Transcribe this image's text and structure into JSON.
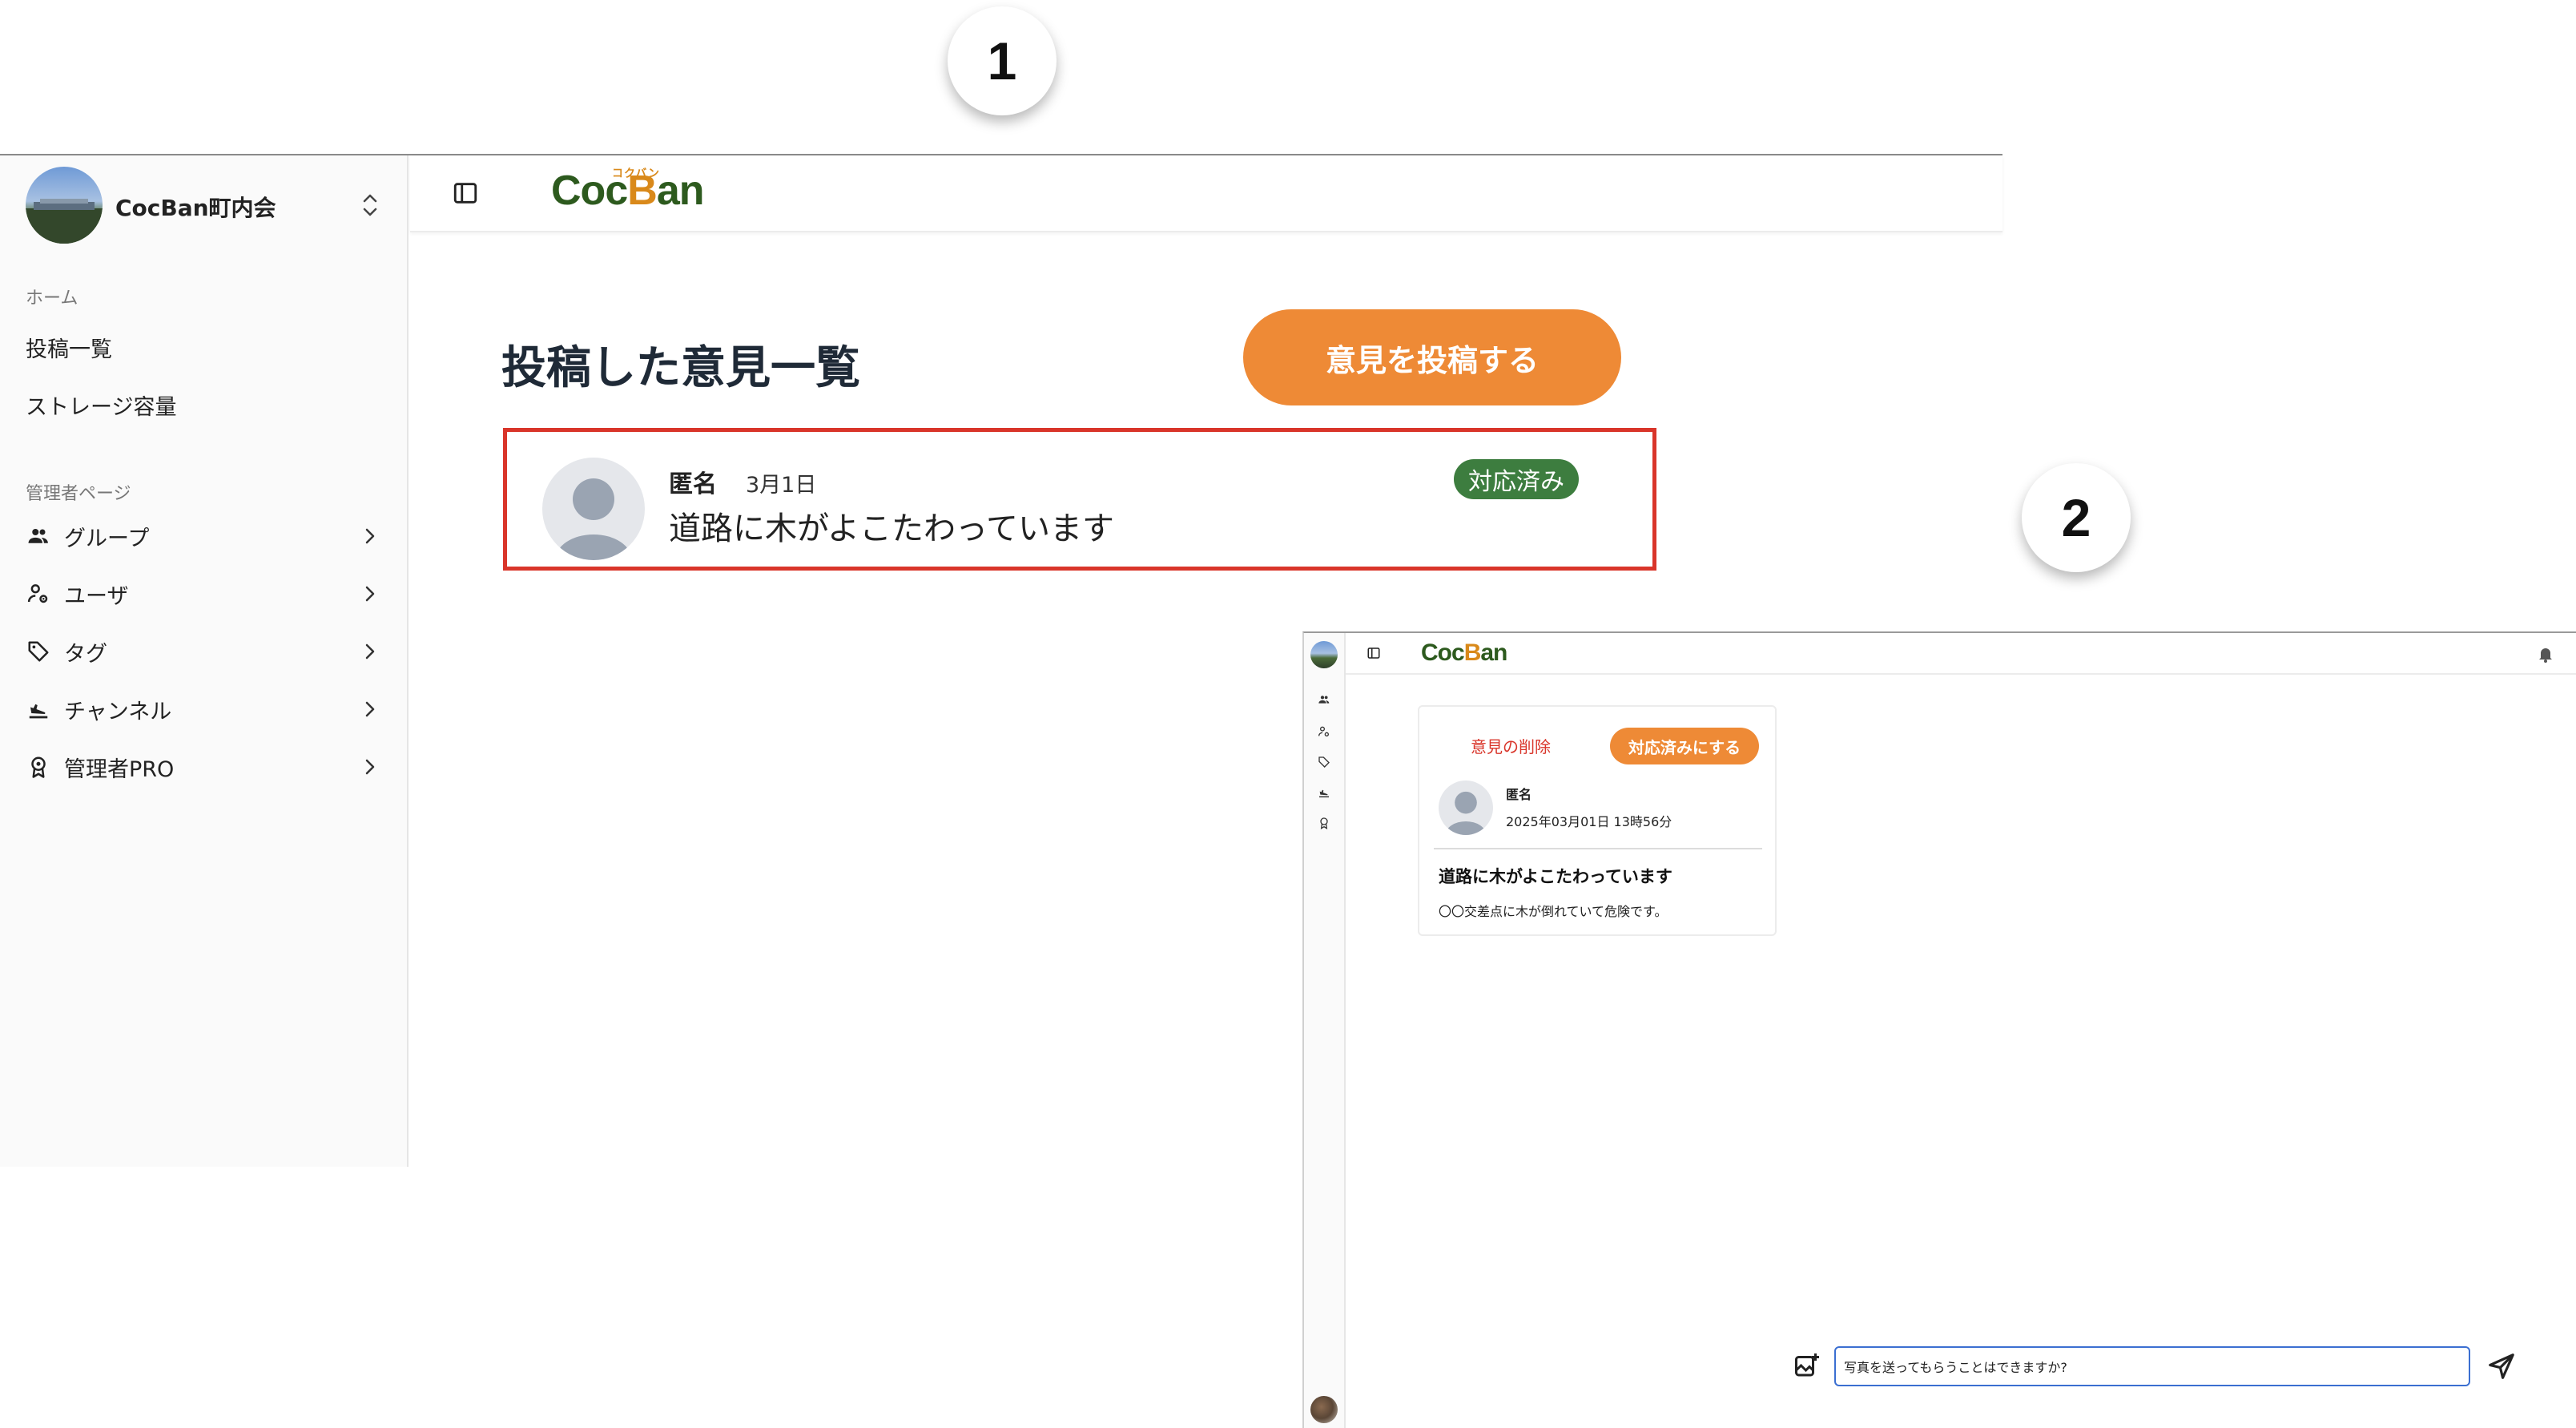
{
  "badges": {
    "step1": "1",
    "step2": "2"
  },
  "screen1": {
    "org_name": "CocBan町内会",
    "section_home": "ホーム",
    "home_items": [
      "投稿一覧",
      "ストレージ容量"
    ],
    "section_admin": "管理者ページ",
    "admin_items": [
      {
        "label": "グループ",
        "icon": "group-icon"
      },
      {
        "label": "ユーザ",
        "icon": "users-settings-icon"
      },
      {
        "label": "タグ",
        "icon": "tag-icon"
      },
      {
        "label": "チャンネル",
        "icon": "channel-icon"
      },
      {
        "label": "管理者PRO",
        "icon": "award-icon"
      }
    ],
    "logo_text_1": "Coc",
    "logo_text_b": "B",
    "logo_text_2": "an",
    "logo_kana": "コクバン",
    "page_title": "投稿した意見一覧",
    "post_button": "意見を投稿する",
    "opinion": {
      "author": "匿名",
      "date": "3月1日",
      "body": "道路に木がよこたわっています",
      "status": "対応済み"
    },
    "colors": {
      "accent": "#ee8a36",
      "status_green": "#3d7d3f",
      "highlight_red": "#d9352a"
    }
  },
  "screen2": {
    "logo_text_1": "Coc",
    "logo_text_b": "B",
    "logo_text_2": "an",
    "delete_link": "意見の削除",
    "resolve_button": "対応済みにする",
    "author": "匿名",
    "datetime": "2025年03月01日 13時56分",
    "title": "道路に木がよこたわっています",
    "body": "〇〇交差点に木が倒れていて危険です。",
    "message_input_value": "写真を送ってもらうことはできますか?"
  }
}
